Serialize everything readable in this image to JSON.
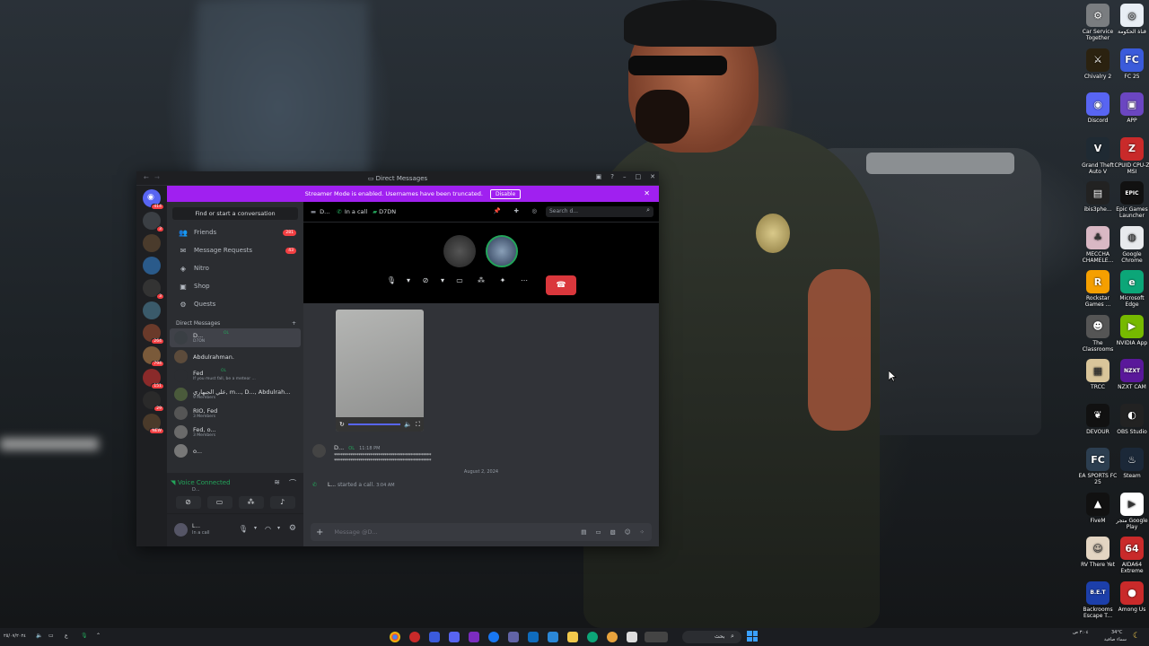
{
  "desktop_icons": [
    {
      "label": "Car Service Together",
      "color": "#7a7d80",
      "glyph": "⚙"
    },
    {
      "label": "قناة الحكومة",
      "color": "#e8eef5",
      "glyph": "◎"
    },
    {
      "label": "Chivalry 2",
      "color": "#2b2210",
      "glyph": "⚔"
    },
    {
      "label": "FC 25",
      "color": "#3b5bdb",
      "glyph": "FC"
    },
    {
      "label": "Discord",
      "color": "#5865f2",
      "glyph": "◉"
    },
    {
      "label": "APP",
      "color": "#6b46c1",
      "glyph": "▣"
    },
    {
      "label": "Grand Theft Auto V",
      "color": "#1f2a33",
      "glyph": "V"
    },
    {
      "label": "CPUID CPU-Z MSI",
      "color": "#c92a2a",
      "glyph": "Z"
    },
    {
      "label": "ibis3phe...",
      "color": "#222",
      "glyph": "▤"
    },
    {
      "label": "Epic Games Launcher",
      "color": "#111",
      "glyph": "EPIC"
    },
    {
      "label": "MECCHA CHAMELE...",
      "color": "#d9b8c4",
      "glyph": "♣"
    },
    {
      "label": "Google Chrome",
      "color": "#e8eaed",
      "glyph": "◍"
    },
    {
      "label": "Rockstar Games ...",
      "color": "#f59f00",
      "glyph": "R"
    },
    {
      "label": "Microsoft Edge",
      "color": "#0ca678",
      "glyph": "e"
    },
    {
      "label": "The Classrooms",
      "color": "#555",
      "glyph": "☻"
    },
    {
      "label": "NVIDIA App",
      "color": "#76b900",
      "glyph": "▶"
    },
    {
      "label": "TRCC",
      "color": "#d9c59a",
      "glyph": "▦"
    },
    {
      "label": "NZXT CAM",
      "color": "#5a189a",
      "glyph": "NZXT"
    },
    {
      "label": "DEVOUR",
      "color": "#111",
      "glyph": "❦"
    },
    {
      "label": "OBS Studio",
      "color": "#222",
      "glyph": "◐"
    },
    {
      "label": "EA SPORTS FC 25",
      "color": "#2c3e50",
      "glyph": "FC"
    },
    {
      "label": "Steam",
      "color": "#1b2838",
      "glyph": "♨"
    },
    {
      "label": "FiveM",
      "color": "#111",
      "glyph": "▲"
    },
    {
      "label": "متجر Google Play",
      "color": "#fff",
      "glyph": "▶"
    },
    {
      "label": "RV There Yet",
      "color": "#e3d5c2",
      "glyph": "☺"
    },
    {
      "label": "AIDA64 Extreme",
      "color": "#c92a2a",
      "glyph": "64"
    },
    {
      "label": "Backrooms Escape T...",
      "color": "#1c3faa",
      "glyph": "B.E.T"
    },
    {
      "label": "Among Us",
      "color": "#c92a2a",
      "glyph": "●"
    }
  ],
  "window": {
    "title": "Direct Messages",
    "streamer_text": "Streamer Mode is enabled. Usernames have been truncated.",
    "disable_label": "Disable",
    "find_label": "Find or start a conversation",
    "nav": [
      {
        "label": "Friends",
        "icon": "friends-icon",
        "glyph": "👥",
        "badge": "281"
      },
      {
        "label": "Message Requests",
        "icon": "mail-icon",
        "glyph": "✉",
        "badge": "43"
      },
      {
        "label": "Nitro",
        "icon": "nitro-icon",
        "glyph": "◈",
        "badge": ""
      },
      {
        "label": "Shop",
        "icon": "shop-icon",
        "glyph": "▣",
        "badge": ""
      },
      {
        "label": "Quests",
        "icon": "quests-icon",
        "glyph": "⚙",
        "badge": ""
      }
    ],
    "dm_header": "Direct Messages",
    "dms": [
      {
        "name": "D...",
        "sub": "D7DN",
        "tag": "OL",
        "color": "#3a3f44",
        "selected": true
      },
      {
        "name": "Abdulrahman.",
        "sub": "",
        "tag": "",
        "color": "#5c4b3b",
        "selected": false
      },
      {
        "name": "Fed",
        "sub": "If you must fall, be a meteor ...",
        "tag": "OL",
        "color": "#2b2d31",
        "selected": false
      },
      {
        "name": "علي الجبهاري, m..., D..., Abdulrah...",
        "sub": "9 Members",
        "tag": "",
        "color": "#4a5a3b",
        "selected": false
      },
      {
        "name": "RIO, Fed",
        "sub": "3 Members",
        "tag": "",
        "color": "#555",
        "selected": false
      },
      {
        "name": "Fed, o...",
        "sub": "3 Members",
        "tag": "",
        "color": "#6a6a6a",
        "selected": false
      },
      {
        "name": "o...",
        "sub": "",
        "tag": "",
        "color": "#777",
        "selected": false
      }
    ],
    "voice_connected": "Voice Connected",
    "voice_sub": "D...",
    "user_name": "L...",
    "user_status": "In a call",
    "server_badges": [
      "414",
      "3",
      "",
      "",
      "3",
      "",
      "264",
      "794",
      "151",
      "29",
      "NEW"
    ],
    "chat_header": {
      "name": "D...",
      "status": "In a call",
      "tag": "D7DN",
      "search_placeholder": "Search d..."
    },
    "message": {
      "author": "D...",
      "tag": "OL",
      "time": "11:18 PM",
      "line1": "************************************************",
      "line2": "************************************************"
    },
    "date_divider": "August 2, 2024",
    "call_notice": {
      "who": "L...",
      "text": "started a call.",
      "time": "3:04 AM"
    },
    "composer_placeholder": "Message @D..."
  },
  "taskbar": {
    "left_text": "٢٥/٠٧/٢٠٢٤",
    "time": "٣:٠٤ ص",
    "temp": "34°C",
    "weather": "سماء صافية",
    "search_text": "بحث"
  }
}
